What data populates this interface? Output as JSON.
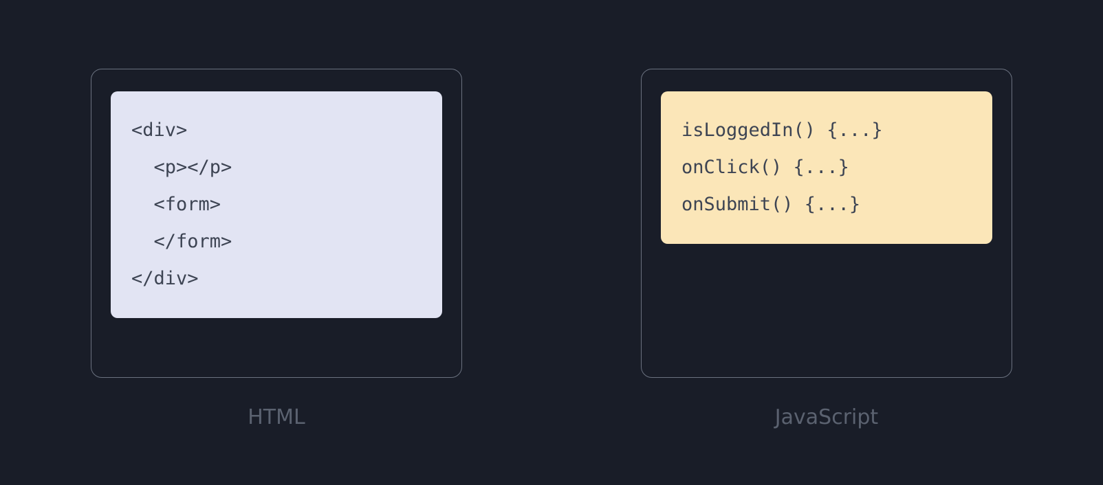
{
  "panels": {
    "html": {
      "label": "HTML",
      "code": "<div>\n  <p></p>\n  <form>\n  </form>\n</div>"
    },
    "javascript": {
      "label": "JavaScript",
      "code": "isLoggedIn() {...}\nonClick() {...}\nonSubmit() {...}"
    }
  }
}
